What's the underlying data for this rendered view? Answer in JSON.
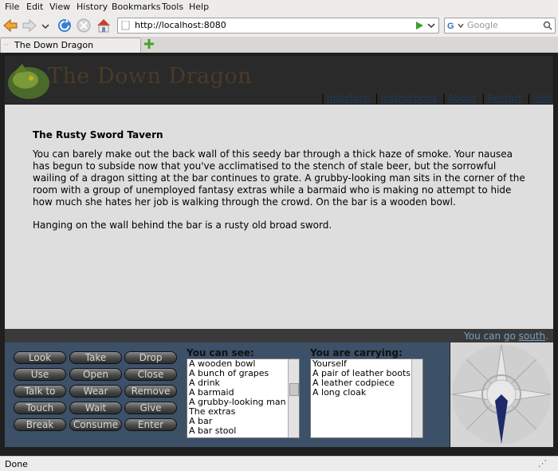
{
  "browser": {
    "menus": [
      "File",
      "Edit",
      "View",
      "History",
      "Bookmarks",
      "Tools",
      "Help"
    ],
    "url": "http://localhost:8080",
    "search_placeholder": "Google",
    "tab_title": "The Down Dragon",
    "status": "Done"
  },
  "game": {
    "title": "The Down Dragon",
    "nav_links": [
      "Interface",
      "Instructions",
      "About",
      "Restart",
      "Hint"
    ],
    "room_title": "The Rusty Sword Tavern",
    "description": "You can barely make out the back wall of this seedy bar through a thick haze of smoke. Your nausea has begun to subside now that you've acclimatised to the stench of stale beer, but the sorrowful wailing of a dragon sitting at the bar continues to grate. A grubby-looking man sits in the corner of the room with a group of unemployed fantasy extras while a barmaid who is making no attempt to hide how much she hates her job is walking through the crowd. On the bar is a wooden bowl.",
    "description2": "Hanging on the wall behind the bar is a rusty old broad sword.",
    "exit_prefix": "You can go",
    "exit_dir": "south",
    "exit_suffix": ".",
    "verbs": [
      "Look",
      "Take",
      "Drop",
      "Use",
      "Open",
      "Close",
      "Talk to",
      "Wear",
      "Remove",
      "Touch",
      "Wait",
      "Give",
      "Break",
      "Consume",
      "Enter"
    ],
    "see_label": "You can see:",
    "see_items": [
      "A wooden bowl",
      "A bunch of grapes",
      "A drink",
      "A barmaid",
      "A grubby-looking man",
      "The extras",
      "A bar",
      "A bar stool"
    ],
    "carry_label": "You are carrying:",
    "carry_items": [
      "Yourself",
      "A pair of leather boots",
      "A leather codpiece",
      "A long cloak"
    ]
  },
  "colors": {
    "panel": "#3c5068",
    "content": "#dedede",
    "link": "#1f3a5a",
    "exit": "#7aa0c0"
  },
  "icons": [
    "back-icon",
    "forward-icon",
    "dropdown-icon",
    "reload-icon",
    "stop-icon",
    "home-icon",
    "page-icon",
    "go-icon",
    "google-icon",
    "search-icon",
    "new-tab-icon",
    "dragon-logo",
    "compass-rose",
    "resize-grip-icon"
  ]
}
